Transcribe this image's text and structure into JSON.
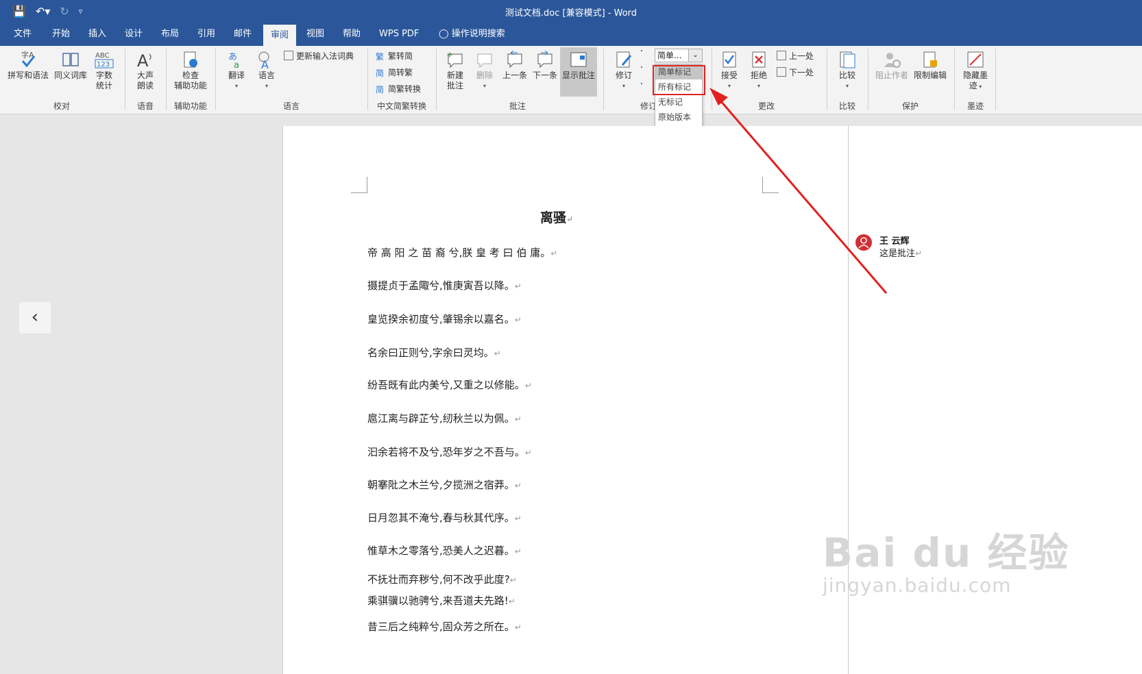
{
  "window": {
    "title": "测试文档.doc [兼容模式]  -  Word"
  },
  "qat": {
    "save_icon": "floppy-icon",
    "undo_icon": "undo-icon",
    "redo_icon": "redo-icon",
    "customize_icon": "caret-icon"
  },
  "tabs": [
    {
      "label": "文件"
    },
    {
      "label": "开始"
    },
    {
      "label": "插入"
    },
    {
      "label": "设计"
    },
    {
      "label": "布局"
    },
    {
      "label": "引用"
    },
    {
      "label": "邮件"
    },
    {
      "label": "审阅"
    },
    {
      "label": "视图"
    },
    {
      "label": "帮助"
    },
    {
      "label": "WPS PDF"
    },
    {
      "label": "操作说明搜索"
    }
  ],
  "ribbon": {
    "proofing": {
      "spell": "拼写和语法",
      "thesaurus": "同义词库",
      "wordcount_1": "字数",
      "wordcount_2": "统计",
      "wordcount_icon_text": "ABC\n123",
      "group": "校对"
    },
    "speech": {
      "read_1": "大声",
      "read_2": "朗读",
      "group": "语音"
    },
    "accessibility": {
      "check_1": "检查",
      "check_2": "辅助功能",
      "group": "辅助功能"
    },
    "language": {
      "translate": "翻译",
      "language": "语言",
      "update_ime": "更新输入法词典",
      "group": "语言"
    },
    "chinese": {
      "to_simp": "繁转简",
      "to_trad": "简转繁",
      "convert": "简繁转换",
      "group": "中文简繁转换"
    },
    "comments": {
      "new_1": "新建",
      "new_2": "批注",
      "delete": "删除",
      "prev": "上一条",
      "next": "下一条",
      "show": "显示批注",
      "group": "批注"
    },
    "tracking": {
      "track": "修订",
      "group": "修订",
      "combo_value": "简单...",
      "menu": [
        "简单标记",
        "所有标记",
        "无标记",
        "原始版本"
      ]
    },
    "changes": {
      "accept": "接受",
      "reject": "拒绝",
      "prev": "上一处",
      "next": "下一处",
      "group": "更改"
    },
    "compare": {
      "compare": "比较",
      "group": "比较"
    },
    "protect": {
      "block": "阻止作者",
      "restrict": "限制编辑",
      "group": "保护"
    },
    "ink": {
      "hide_1": "隐藏墨",
      "hide_2": "迹",
      "group": "墨迹"
    }
  },
  "document": {
    "title": "离骚",
    "paragraphs": [
      "帝 高 阳 之 苗 裔 兮,朕 皇 考 曰 伯 庸。",
      "摄提贞于孟陬兮,惟庚寅吾以降。",
      "皇览揆余初度兮,肇锡余以嘉名。",
      "名余曰正则兮,字余曰灵均。",
      "纷吾既有此内美兮,又重之以修能。",
      "扈江离与辟芷兮,纫秋兰以为佩。",
      "汩余若将不及兮,恐年岁之不吾与。",
      "朝搴阰之木兰兮,夕揽洲之宿莽。",
      "日月忽其不淹兮,春与秋其代序。",
      "惟草木之零落兮,恐美人之迟暮。",
      "不抚壮而弃秽兮,何不改乎此度?",
      "乘骐骥以驰骋兮,来吾道夫先路!",
      "昔三后之纯粹兮,固众芳之所在。"
    ],
    "para_mark": "↵"
  },
  "comment": {
    "author": "王 云辉",
    "text": "这是批注"
  },
  "watermark": {
    "line1": "Bai du 经验",
    "line2": "jingyan.baidu.com"
  },
  "colors": {
    "accent": "#2b579a",
    "highlight": "#e32020"
  }
}
